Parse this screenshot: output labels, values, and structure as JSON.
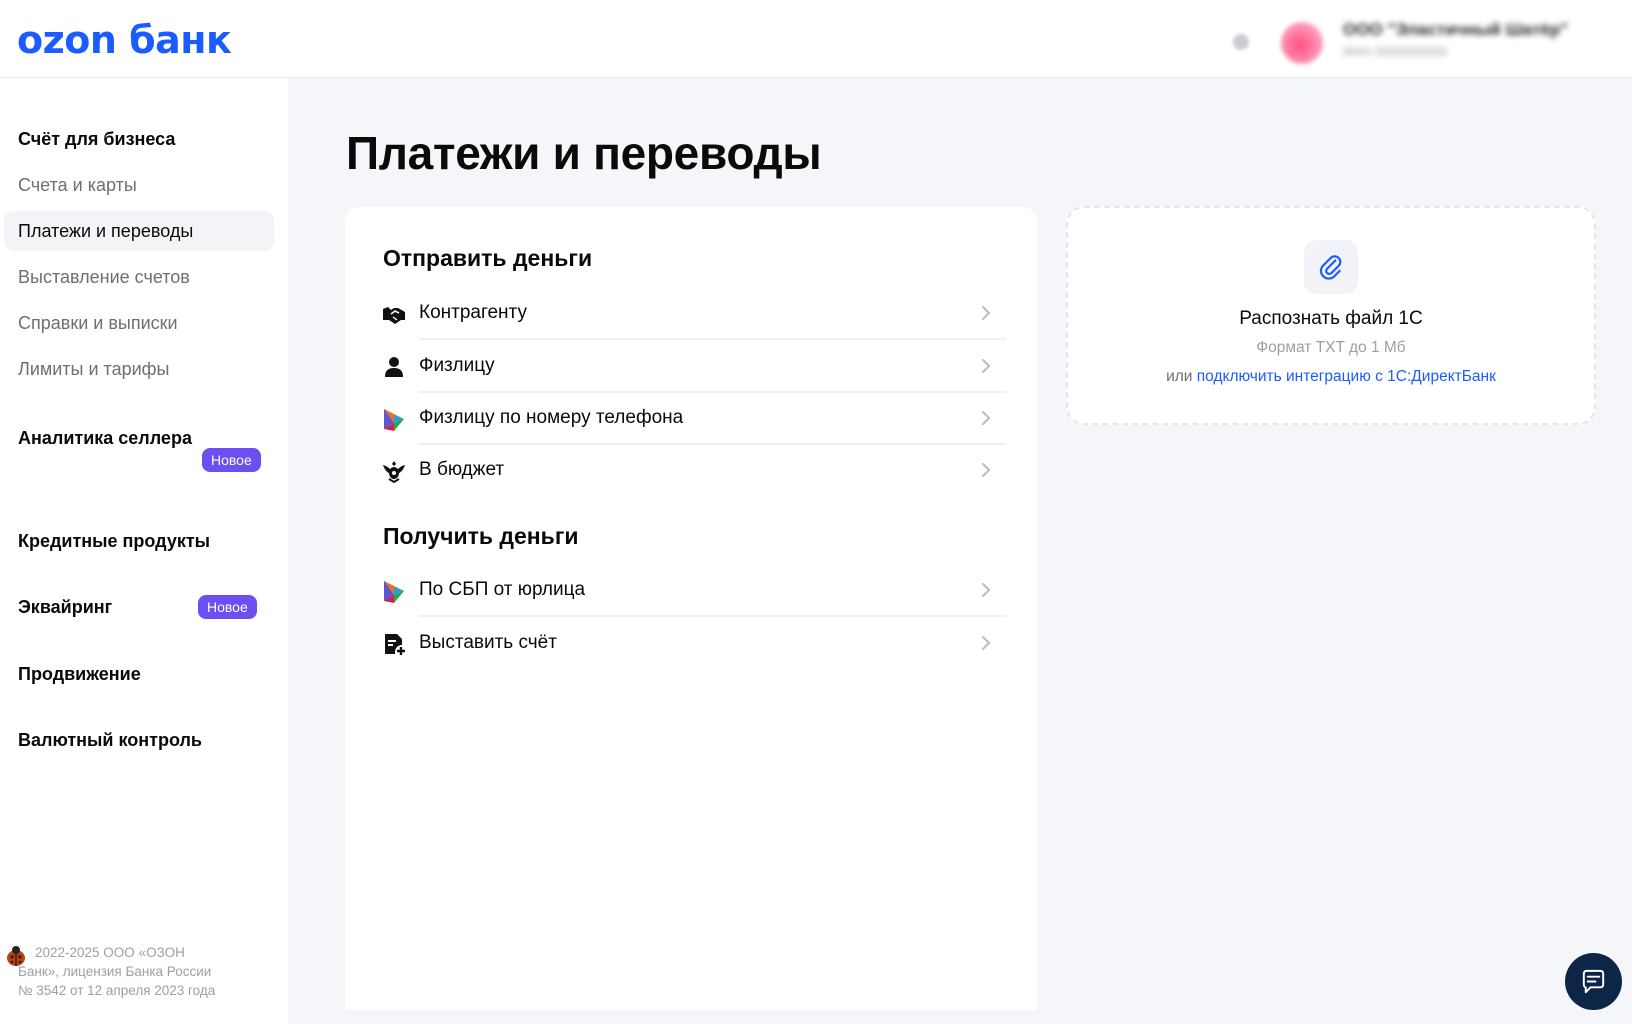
{
  "header": {
    "logo": "ozon банк",
    "company_name": "ООО \"Эластичный Шатёр\"",
    "company_inn": "ИНН 0000000000"
  },
  "sidebar": {
    "items": [
      {
        "label": "Счёт для бизнеса"
      },
      {
        "label": "Счета и карты"
      },
      {
        "label": "Платежи и переводы"
      },
      {
        "label": "Выставление счетов"
      },
      {
        "label": "Справки и выписки"
      },
      {
        "label": "Лимиты и тарифы"
      },
      {
        "label": "Аналитика селлера",
        "badge": "Новое"
      },
      {
        "label": "Кредитные продукты"
      },
      {
        "label": "Эквайринг",
        "badge": "Новое"
      },
      {
        "label": "Продвижение"
      },
      {
        "label": "Валютный контроль"
      }
    ],
    "footer": {
      "line1": "2022-2025 ООО «ОЗОН",
      "line2": "Банк», лицензия Банка России",
      "line3": "№ 3542 от 12 апреля 2023 года"
    }
  },
  "main": {
    "title": "Платежи и переводы",
    "send": {
      "title": "Отправить деньги",
      "rows": [
        {
          "label": "Контрагенту",
          "icon": "handshake-icon"
        },
        {
          "label": "Физлицу",
          "icon": "person-icon"
        },
        {
          "label": "Физлицу по номеру телефона",
          "icon": "sbp-icon"
        },
        {
          "label": "В бюджет",
          "icon": "emblem-icon"
        }
      ]
    },
    "receive": {
      "title": "Получить деньги",
      "rows": [
        {
          "label": "По СБП от юрлица",
          "icon": "sbp-icon"
        },
        {
          "label": "Выставить счёт",
          "icon": "invoice-add-icon"
        }
      ]
    }
  },
  "upload": {
    "title": "Распознать файл 1С",
    "subtitle": "Формат TXT до 1 Мб",
    "or_text": "или",
    "link": "подключить интеграцию с 1С:ДиректБанк"
  },
  "colors": {
    "brand": "#1a5cff",
    "badge": "#6b4ff0",
    "chat_button": "#0d2647"
  }
}
